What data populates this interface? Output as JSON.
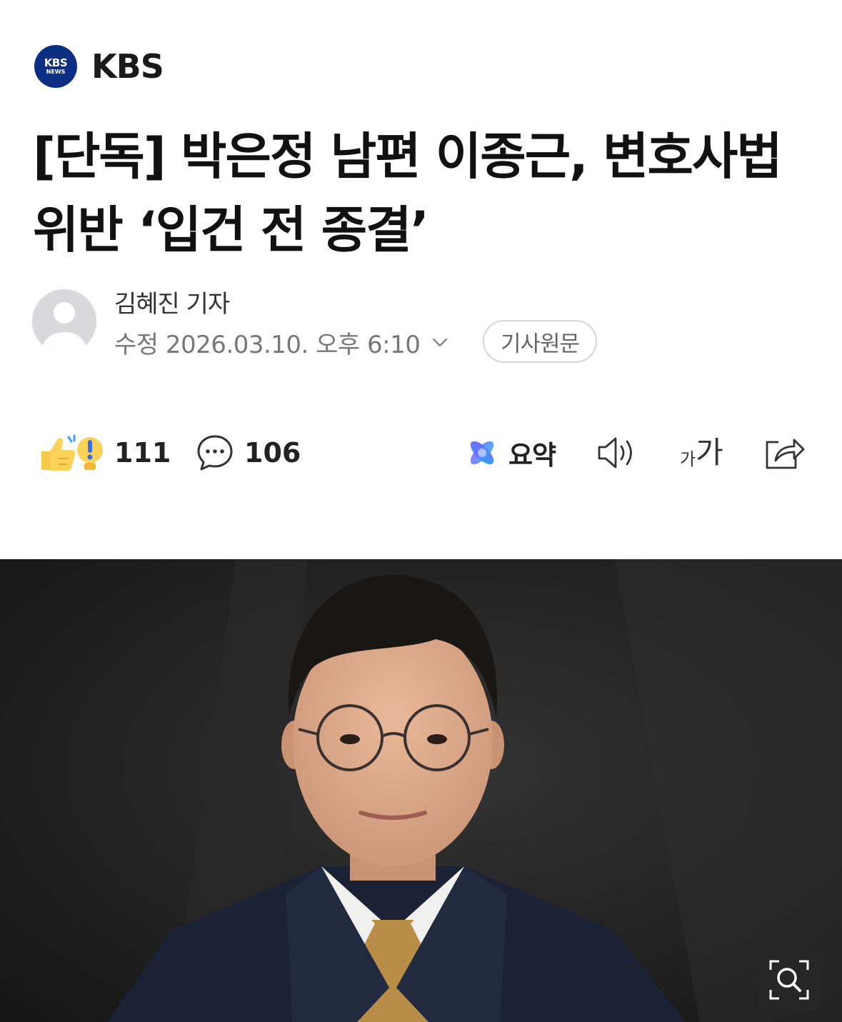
{
  "press": {
    "logo_line1": "KBS",
    "logo_line2": "NEWS",
    "name": "KBS",
    "logo_color": "#0b2d82"
  },
  "article": {
    "headline": "[단독] 박은정 남편 이종근, 변호사법 위반 ‘입건 전 종결’",
    "author": "김혜진 기자",
    "modified": "수정 2026.03.10. 오후 6:10",
    "original_button": "기사원문"
  },
  "actions": {
    "reaction_count": "111",
    "comment_count": "106",
    "summary_label": "요약",
    "icons": [
      "reaction-icon",
      "comment-icon",
      "summary-icon",
      "speaker-icon",
      "font-size-icon",
      "share-icon",
      "zoom-icon"
    ]
  },
  "font_size_icon": {
    "small": "가",
    "large": "가"
  }
}
